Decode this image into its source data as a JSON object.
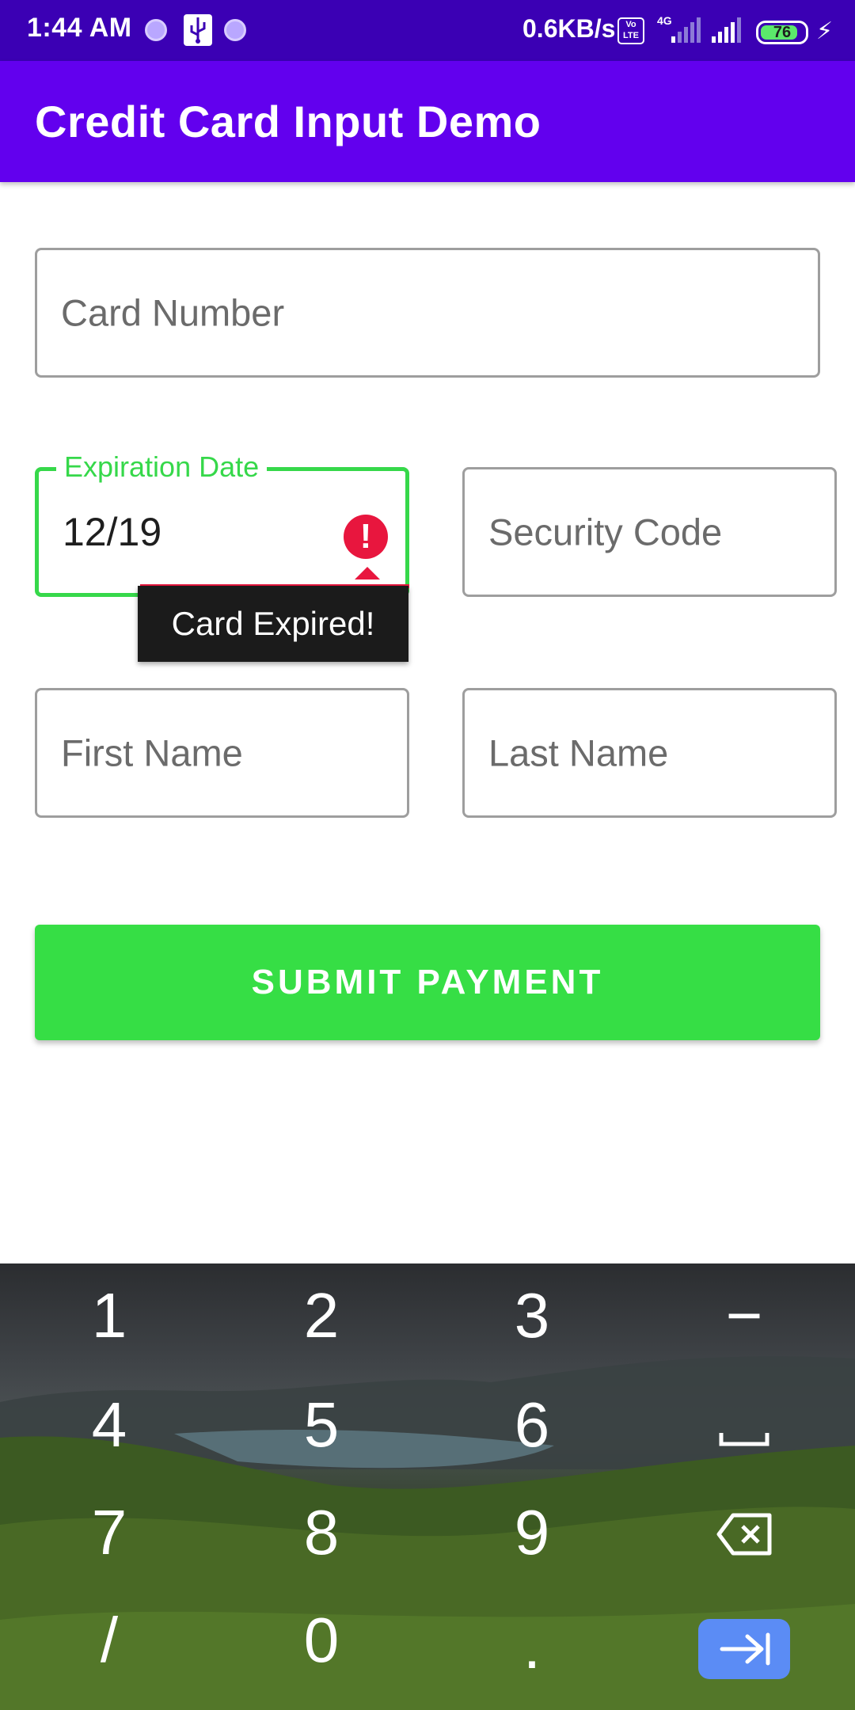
{
  "status_bar": {
    "time": "1:44 AM",
    "network_speed": "0.6KB/s",
    "volte": "Vo LTE",
    "network_type": "4G",
    "battery_level": "76",
    "icons": [
      "sync-icon",
      "usb-icon",
      "sync-icon",
      "volte-icon",
      "signal-icon",
      "signal-icon",
      "battery-icon",
      "charging-icon"
    ]
  },
  "app_bar": {
    "title": "Credit Card Input Demo"
  },
  "form": {
    "card_number": {
      "placeholder": "Card Number",
      "value": ""
    },
    "expiration_date": {
      "label": "Expiration Date",
      "value": "12/19",
      "error": "Card Expired!"
    },
    "security_code": {
      "placeholder": "Security Code",
      "value": ""
    },
    "first_name": {
      "placeholder": "First Name",
      "value": ""
    },
    "last_name": {
      "placeholder": "Last Name",
      "value": ""
    },
    "submit_label": "SUBMIT PAYMENT"
  },
  "colors": {
    "status_bar": "#3b00b4",
    "app_bar": "#6200ee",
    "accent_green": "#36de45",
    "error_red": "#e8163e",
    "enter_key": "#5b8cf5"
  },
  "keyboard": {
    "keys": [
      "1",
      "2",
      "3",
      "−",
      "4",
      "5",
      "6",
      "",
      "7",
      "8",
      "9",
      "",
      "/",
      "0",
      ".",
      ""
    ],
    "icons": [
      "space-icon",
      "backspace-icon",
      "next-field-icon"
    ]
  }
}
